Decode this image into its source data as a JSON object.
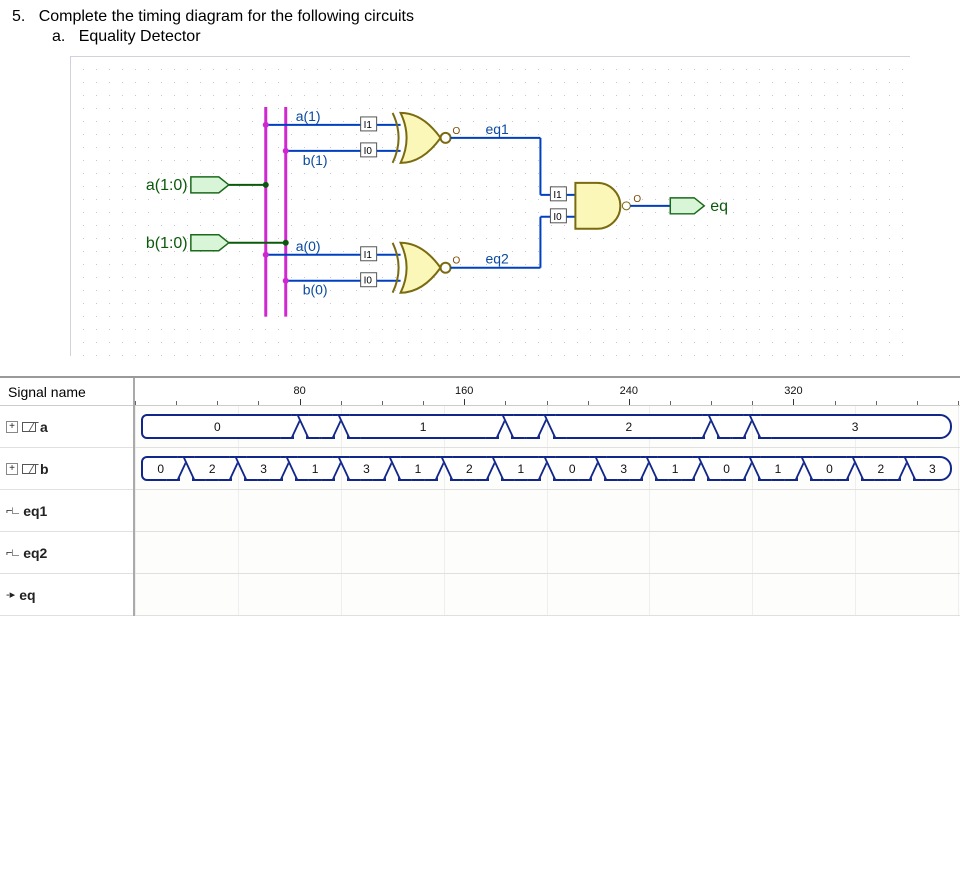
{
  "question": {
    "num": "5.",
    "text": "Complete the timing diagram for the following circuits",
    "sub_letter": "a.",
    "sub_text": "Equality Detector"
  },
  "schematic": {
    "inputs": {
      "a": "a(1:0)",
      "b": "b(1:0)"
    },
    "wires": {
      "a1": "a(1)",
      "b1": "b(1)",
      "a0": "a(0)",
      "b0": "b(0)"
    },
    "mid": {
      "eq1": "eq1",
      "eq2": "eq2"
    },
    "out": "eq",
    "inv_labels": {
      "top1": "I1",
      "top0": "I0",
      "bot1": "I1",
      "bot0": "I0"
    },
    "bubble": "O"
  },
  "timing": {
    "ruler": {
      "start": 0,
      "end": 400,
      "major": [
        80,
        160,
        240,
        320
      ],
      "minor_step": 20
    },
    "signal_name_header": "Signal name",
    "signals": [
      {
        "name": "a",
        "kind": "bus",
        "expand": true,
        "segments": [
          {
            "label": "0",
            "from": 0,
            "to": 80
          },
          {
            "label": "",
            "from": 80,
            "to": 100
          },
          {
            "label": "1",
            "from": 100,
            "to": 180
          },
          {
            "label": "",
            "from": 180,
            "to": 200
          },
          {
            "label": "2",
            "from": 200,
            "to": 280
          },
          {
            "label": "",
            "from": 280,
            "to": 300
          },
          {
            "label": "3",
            "from": 300,
            "to": 400
          }
        ]
      },
      {
        "name": "b",
        "kind": "bus",
        "expand": true,
        "segments": [
          {
            "label": "0",
            "from": 0,
            "to": 25
          },
          {
            "label": "2",
            "from": 25,
            "to": 50
          },
          {
            "label": "3",
            "from": 50,
            "to": 75
          },
          {
            "label": "1",
            "from": 75,
            "to": 100
          },
          {
            "label": "3",
            "from": 100,
            "to": 125
          },
          {
            "label": "1",
            "from": 125,
            "to": 150
          },
          {
            "label": "2",
            "from": 150,
            "to": 175
          },
          {
            "label": "1",
            "from": 175,
            "to": 200
          },
          {
            "label": "0",
            "from": 200,
            "to": 225
          },
          {
            "label": "3",
            "from": 225,
            "to": 250
          },
          {
            "label": "1",
            "from": 250,
            "to": 275
          },
          {
            "label": "0",
            "from": 275,
            "to": 300
          },
          {
            "label": "1",
            "from": 300,
            "to": 325
          },
          {
            "label": "0",
            "from": 325,
            "to": 350
          },
          {
            "label": "2",
            "from": 350,
            "to": 375
          },
          {
            "label": "3",
            "from": 375,
            "to": 400
          }
        ]
      },
      {
        "name": "eq1",
        "kind": "wave",
        "expand": false
      },
      {
        "name": "eq2",
        "kind": "wave",
        "expand": false
      },
      {
        "name": "eq",
        "kind": "bit",
        "expand": false
      }
    ]
  }
}
